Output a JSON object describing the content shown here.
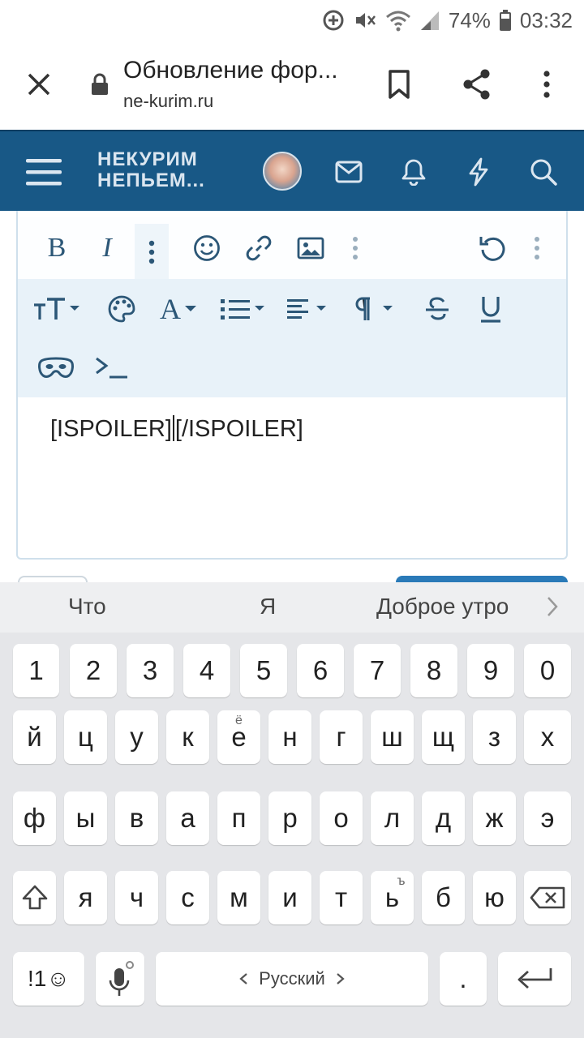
{
  "status_bar": {
    "battery": "74%",
    "time": "03:32",
    "icons": [
      "data-saver-icon",
      "mute-icon",
      "wifi-icon",
      "signal-icon",
      "battery-icon"
    ]
  },
  "browser": {
    "title": "Обновление фор...",
    "url": "ne-kurim.ru",
    "icons": [
      "close-icon",
      "lock-icon",
      "bookmark-icon",
      "share-icon",
      "more-vert-icon"
    ]
  },
  "site_header": {
    "logo_line1": "НЕКУРИМ",
    "logo_line2": "НЕПЬЕМ...",
    "brand_color": "#185886",
    "icons": [
      "menu-icon",
      "avatar",
      "mail-icon",
      "bell-icon",
      "lightning-icon",
      "search-icon"
    ]
  },
  "editor": {
    "toolbar_row1": [
      "bold-icon",
      "italic-icon",
      "more-vert-icon",
      "smile-icon",
      "link-icon",
      "image-icon",
      "more-vert-icon",
      "undo-icon",
      "more-vert-icon"
    ],
    "bold_label": "B",
    "italic_label": "I",
    "toolbar_row2": [
      "text-size-icon",
      "palette-icon",
      "font-color-icon",
      "list-icon",
      "align-icon",
      "paragraph-icon",
      "strikethrough-icon",
      "underline-icon"
    ],
    "font_color_label": "A",
    "toolbar_row3": [
      "spoiler-mask-icon",
      "code-icon"
    ],
    "content_before_caret": "[ISPOILER]",
    "content_after_caret": "[/ISPOILER]"
  },
  "keyboard": {
    "suggestions": [
      "Что",
      "Я",
      "Доброе утро"
    ],
    "row_numbers": [
      "1",
      "2",
      "3",
      "4",
      "5",
      "6",
      "7",
      "8",
      "9",
      "0"
    ],
    "row1": [
      "й",
      "ц",
      "у",
      "к",
      "е",
      "н",
      "г",
      "ш",
      "щ",
      "з",
      "х"
    ],
    "row1_hint_e": "ё",
    "row2": [
      "ф",
      "ы",
      "в",
      "а",
      "п",
      "р",
      "о",
      "л",
      "д",
      "ж",
      "э"
    ],
    "row3": [
      "я",
      "ч",
      "с",
      "м",
      "и",
      "т",
      "ь",
      "б",
      "ю"
    ],
    "row3_hint_soft": "ъ",
    "symbols_label": "!1☺",
    "space_label": "Русский",
    "period_label": "."
  }
}
